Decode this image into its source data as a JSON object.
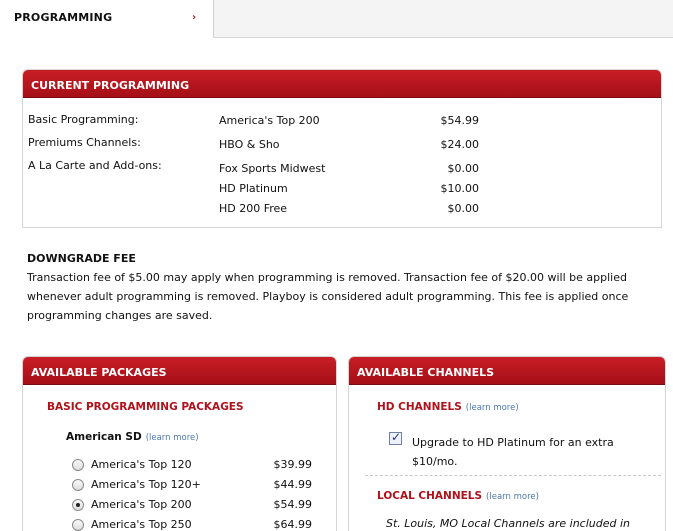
{
  "tab": {
    "label": "PROGRAMMING",
    "arrow": "›"
  },
  "current": {
    "title": "CURRENT PROGRAMMING",
    "labels": [
      "Basic Programming:",
      "Premiums Channels:",
      "A La Carte and Add-ons:"
    ],
    "items": [
      {
        "name": "America's Top 200",
        "price": "$54.99"
      },
      {
        "name": "HBO & Sho",
        "price": "$24.00"
      },
      {
        "name": "Fox Sports Midwest",
        "price": "$0.00"
      },
      {
        "name": "HD Platinum",
        "price": "$10.00"
      },
      {
        "name": "HD 200 Free",
        "price": "$0.00"
      }
    ]
  },
  "fee": {
    "title": "DOWNGRADE FEE",
    "text": "Transaction fee of $5.00 may apply when programming is removed. Transaction fee of $20.00 will be applied whenever adult programming is removed. Playboy is considered adult programming. This fee is applied once programming changes are saved."
  },
  "packages": {
    "title": "AVAILABLE PACKAGES",
    "section": "BASIC PROGRAMMING PACKAGES",
    "group": "American SD",
    "learn_more": "(learn more)",
    "rows": [
      {
        "name": "America's Top 120",
        "price": "$39.99",
        "selected": false
      },
      {
        "name": "America's Top 120+",
        "price": "$44.99",
        "selected": false
      },
      {
        "name": "America's Top 200",
        "price": "$54.99",
        "selected": true
      },
      {
        "name": "America's Top 250",
        "price": "$64.99",
        "selected": false
      }
    ]
  },
  "channels": {
    "title": "AVAILABLE CHANNELS",
    "hd_title": "HD CHANNELS",
    "hd_learn_more": "(learn more)",
    "hd_option": "Upgrade to HD Platinum for an extra $10/mo.",
    "hd_checked": true,
    "local_title": "LOCAL CHANNELS",
    "local_learn_more": "(learn more)",
    "local_text": "St. Louis, MO Local Channels are included in"
  }
}
